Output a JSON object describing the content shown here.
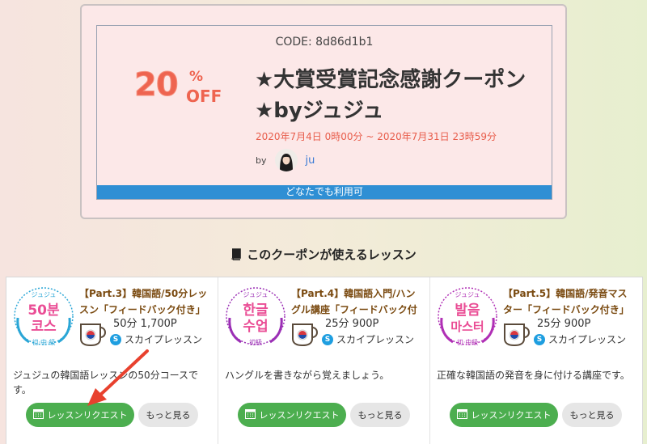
{
  "coupon": {
    "code": "CODE: 8d86d1b1",
    "discount_number": "20",
    "discount_percent": "%",
    "discount_off": "OFF",
    "title": "★大賞受賞記念感謝クーポン★byジュジュ",
    "period": "2020年7月4日 0時00分 ~ 2020年7月31日 23時59分",
    "by_label": "by",
    "author": "ju",
    "availability": "どなたでも利用可"
  },
  "section": {
    "title": "このクーポンが使えるレッスン",
    "icon": "book-icon"
  },
  "lessons": [
    {
      "logo_top": "ジュジュ",
      "logo_line1": "50분",
      "logo_line2": "코스",
      "logo_level": "初·中·級",
      "logo_color": "#2aa6d6",
      "title": "【Part.3】韓国語/50分レッスン「フィードバック付き」",
      "price": "50分 1,700P",
      "skype": "スカイプレッスン",
      "description": "ジュジュの韓国語レッスンの50分コースです。",
      "request_label": "レッスンリクエスト",
      "more_label": "もっと見る"
    },
    {
      "logo_top": "ジュジュ",
      "logo_line1": "한글",
      "logo_line2": "수업",
      "logo_level": "初級",
      "logo_color": "#9b2fb5",
      "title": "【Part.4】韓国語入門/ハングル講座「フィードバック付",
      "price": "25分 900P",
      "skype": "スカイプレッスン",
      "description": "ハングルを書きながら覚えましょう。",
      "request_label": "レッスンリクエスト",
      "more_label": "もっと見る"
    },
    {
      "logo_top": "ジュジュ",
      "logo_line1": "발음",
      "logo_line2": "마스터",
      "logo_level": "初·中級",
      "logo_color": "#b02fb5",
      "title": "【Part.5】韓国語/発音マスター「フィードバック付き」",
      "price": "25分 900P",
      "skype": "スカイプレッスン",
      "description": "正確な韓国語の発音を身に付ける講座です。",
      "request_label": "レッスンリクエスト",
      "more_label": "もっと見る"
    }
  ],
  "colors": {
    "accent_green": "#4cae4f",
    "banner_blue": "#2f8fd4",
    "discount_red": "#ee6450",
    "annotation_arrow": "#e8412e"
  }
}
